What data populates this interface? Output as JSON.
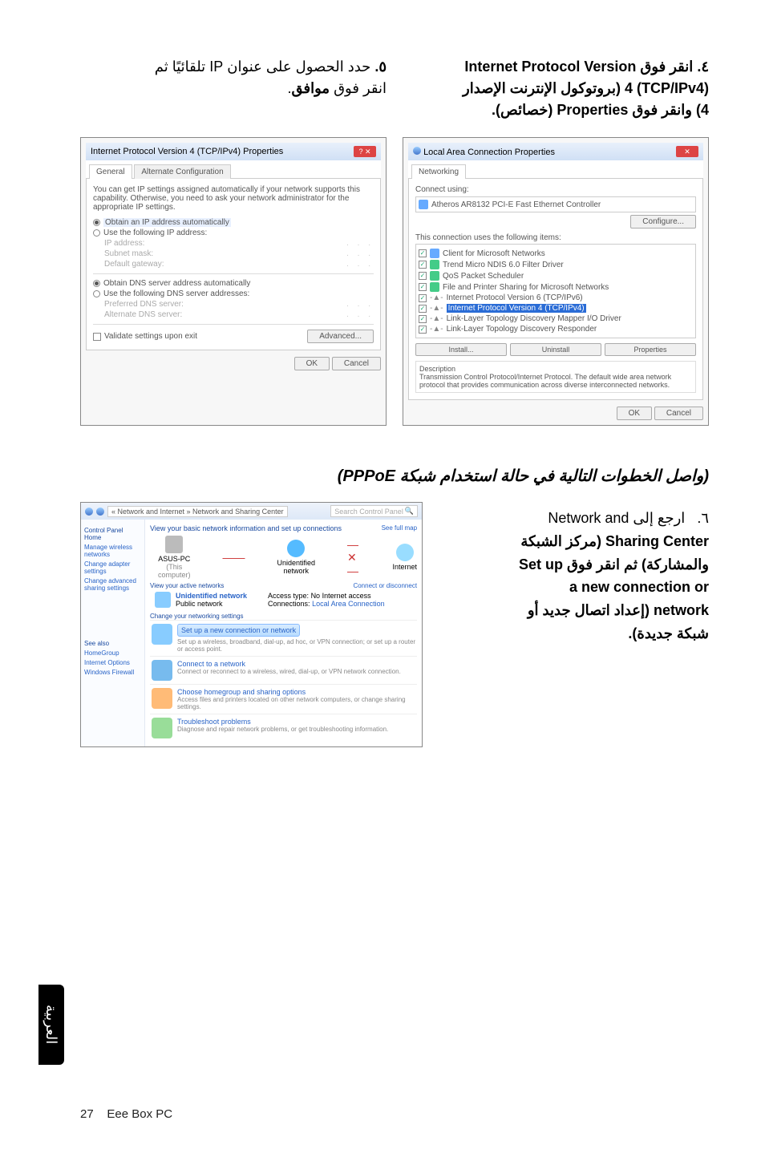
{
  "top": {
    "step4_num": "٤.",
    "step4_line1": "انقر فوق Internet Protocol Version",
    "step4_line2": "(TCP/IPv4) 4 (بروتوكول الإنترنت الإصدار",
    "step4_line3": "4) وانقر فوق Properties (خصائص).",
    "step5_num": "٥.",
    "step5_line1": "حدد الحصول على عنوان IP تلقائيًا ثم",
    "step5_line2": "انقر فوق موافق."
  },
  "dlg1": {
    "title": "Internet Protocol Version 4 (TCP/IPv4) Properties",
    "tab_general": "General",
    "tab_alt": "Alternate Configuration",
    "para": "You can get IP settings assigned automatically if your network supports this capability. Otherwise, you need to ask your network administrator for the appropriate IP settings.",
    "r1": "Obtain an IP address automatically",
    "r2": "Use the following IP address:",
    "f_ip": "IP address:",
    "f_sub": "Subnet mask:",
    "f_gw": "Default gateway:",
    "r3": "Obtain DNS server address automatically",
    "r4": "Use the following DNS server addresses:",
    "f_dns1": "Preferred DNS server:",
    "f_dns2": "Alternate DNS server:",
    "validate": "Validate settings upon exit",
    "advanced": "Advanced...",
    "ok": "OK",
    "cancel": "Cancel"
  },
  "dlg2": {
    "title": "Local Area Connection Properties",
    "tab": "Networking",
    "connect_using": "Connect using:",
    "adapter": "Atheros AR8132 PCI-E Fast Ethernet Controller",
    "configure": "Configure...",
    "uses_items": "This connection uses the following items:",
    "items": [
      "Client for Microsoft Networks",
      "Trend Micro NDIS 6.0 Filter Driver",
      "QoS Packet Scheduler",
      "File and Printer Sharing for Microsoft Networks",
      "Internet Protocol Version 6 (TCP/IPv6)",
      "Internet Protocol Version 4 (TCP/IPv4)",
      "Link-Layer Topology Discovery Mapper I/O Driver",
      "Link-Layer Topology Discovery Responder"
    ],
    "install": "Install...",
    "uninstall": "Uninstall",
    "properties": "Properties",
    "desc_label": "Description",
    "desc_text": "Transmission Control Protocol/Internet Protocol. The default wide area network protocol that provides communication across diverse interconnected networks.",
    "ok": "OK",
    "cancel": "Cancel"
  },
  "mid_heading": "(واصل الخطوات التالية في حالة استخدام شبكة PPPoE)",
  "step6": {
    "num": "٦.",
    "l1": "ارجع إلى Network and",
    "l2": "Sharing Center (مركز الشبكة",
    "l3": "والمشاركة) ثم انقر فوق Set up",
    "l4": "a new connection or",
    "l5": "network (إعداد اتصال جديد أو",
    "l6": "شبكة جديدة)."
  },
  "sharing": {
    "crumb": "« Network and Internet » Network and Sharing Center",
    "search_ph": "Search Control Panel",
    "side_title": "Control Panel Home",
    "side_items": [
      "Manage wireless networks",
      "Change adapter settings",
      "Change advanced sharing settings"
    ],
    "view_title": "View your basic network information and set up connections",
    "see_full": "See full map",
    "pc_label": "ASUS-PC",
    "pc_sub": "(This computer)",
    "unid": "Unidentified network",
    "internet": "Internet",
    "active_title": "View your active networks",
    "connect_link": "Connect or disconnect",
    "unid2": "Unidentified network",
    "public": "Public network",
    "access": "Access type:",
    "no_internet": "No Internet access",
    "connections": "Connections:",
    "lac": "Local Area Connection",
    "change_title": "Change your networking settings",
    "b1_title": "Set up a new connection or network",
    "b1_sub": "Set up a wireless, broadband, dial-up, ad hoc, or VPN connection; or set up a router or access point.",
    "b2_title": "Connect to a network",
    "b2_sub": "Connect or reconnect to a wireless, wired, dial-up, or VPN network connection.",
    "b3_title": "Choose homegroup and sharing options",
    "b3_sub": "Access files and printers located on other network computers, or change sharing settings.",
    "b4_title": "Troubleshoot problems",
    "b4_sub": "Diagnose and repair network problems, or get troubleshooting information.",
    "also": "See also",
    "also_items": [
      "HomeGroup",
      "Internet Options",
      "Windows Firewall"
    ]
  },
  "footer_page": "27",
  "footer_text": "Eee Box PC",
  "side_label": "العربية"
}
